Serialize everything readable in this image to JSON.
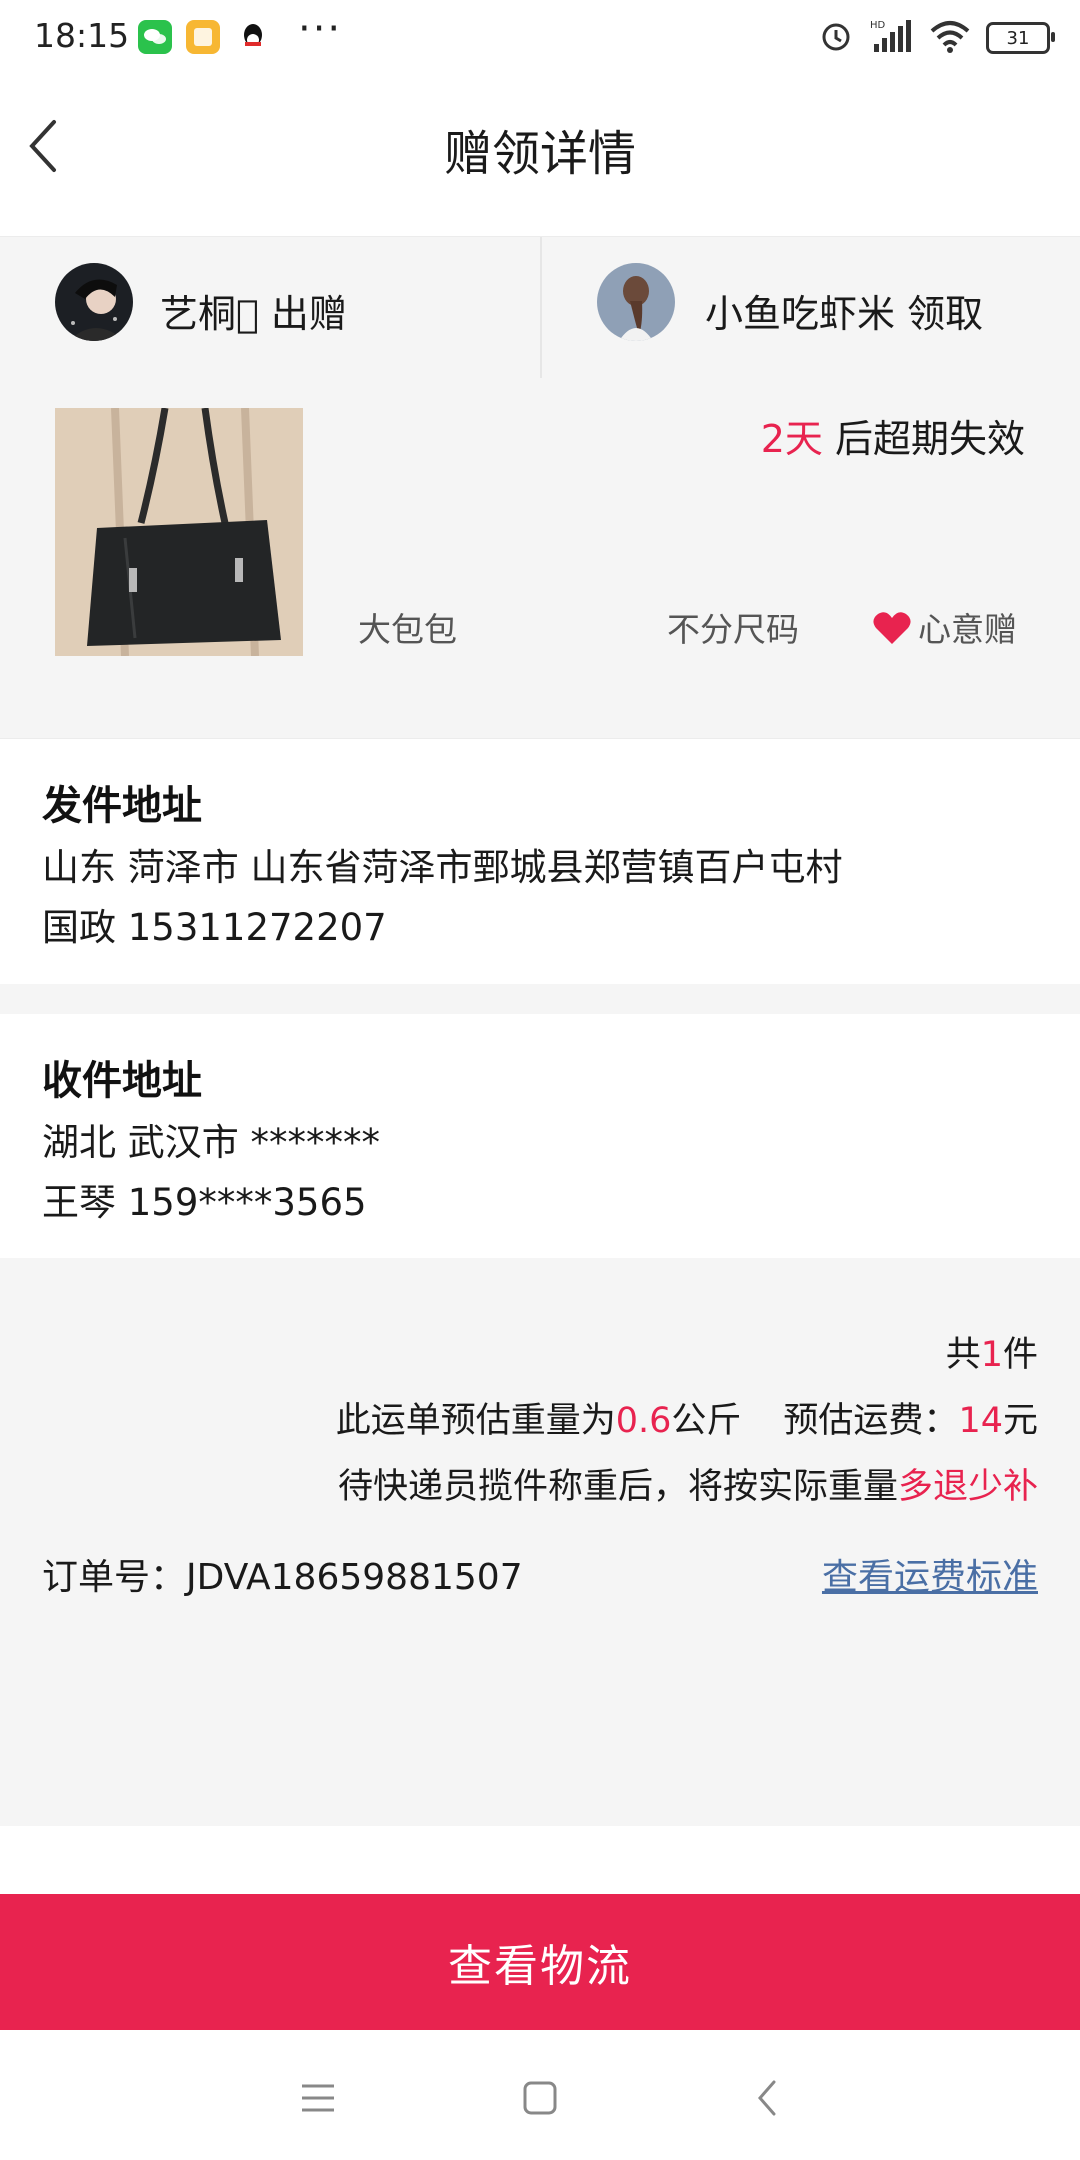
{
  "status_bar": {
    "time": "18:15",
    "battery": "31",
    "icons": [
      "wechat-icon",
      "notes-icon",
      "qq-icon",
      "more-dots-icon",
      "alarm-icon",
      "hd-signal-icon",
      "wifi-icon",
      "battery-icon"
    ]
  },
  "header": {
    "title": "赠领详情",
    "back_icon": "chevron-left-icon"
  },
  "giver": {
    "name": "艺桐\u0000 出赠"
  },
  "receiver": {
    "name": "小鱼吃虾米 领取"
  },
  "product": {
    "expire_days": "2天",
    "expire_suffix": " 后超期失效",
    "name": "大包包",
    "size": "不分尺码",
    "tag": "心意赠"
  },
  "sender_address": {
    "title": "发件地址",
    "line1": "山东 菏泽市 山东省菏泽市鄄城县郑营镇百户屯村",
    "line2": "国政 15311272207"
  },
  "receiver_address": {
    "title": "收件地址",
    "line1": "湖北 武汉市 *******",
    "line2": "王琴 159****3565"
  },
  "summary": {
    "count_prefix": "共",
    "count": "1",
    "count_suffix": "件",
    "weight_prefix": "此运单预估重量为",
    "weight": "0.6",
    "weight_suffix": "公斤",
    "fee_prefix": "预估运费：",
    "fee": "14",
    "fee_suffix": "元",
    "note_prefix": "待快递员揽件称重后，将按实际重量",
    "note_highlight": "多退少补",
    "order_no": "订单号：JDVA18659881507",
    "fee_link": "查看运费标准"
  },
  "action": {
    "track_label": "查看物流"
  },
  "colors": {
    "accent": "#e8234f",
    "link": "#4a6fa5",
    "panel_bg": "#f5f5f5"
  }
}
